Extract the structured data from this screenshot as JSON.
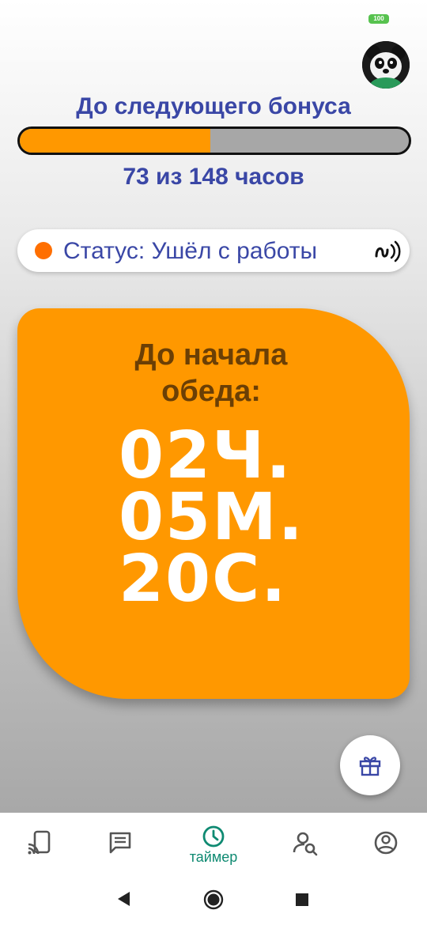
{
  "status_bar": {
    "battery": "100"
  },
  "bonus": {
    "title": "До следующего бонуса",
    "hours_text": "73 из 148 часов",
    "progress_fraction": 0.49
  },
  "status": {
    "label": "Статус: Ушёл с работы",
    "dot_color": "#ff6f00",
    "icon": "nfc-icon"
  },
  "timer": {
    "caption_line1": "До начала",
    "caption_line2": "обеда:",
    "hours": "02Ч.",
    "minutes": "05М.",
    "seconds": "20С.",
    "card_color": "#ff9800"
  },
  "fab": {
    "icon": "gift-icon"
  },
  "nav": {
    "items": [
      {
        "icon": "cast-icon"
      },
      {
        "icon": "chat-icon"
      },
      {
        "icon": "clock-icon",
        "label": "таймер",
        "active": true
      },
      {
        "icon": "person-search-icon"
      },
      {
        "icon": "account-circle-icon"
      }
    ],
    "active_color": "#0f8a72"
  },
  "system_nav": {
    "buttons": [
      "back",
      "home",
      "recents"
    ]
  }
}
